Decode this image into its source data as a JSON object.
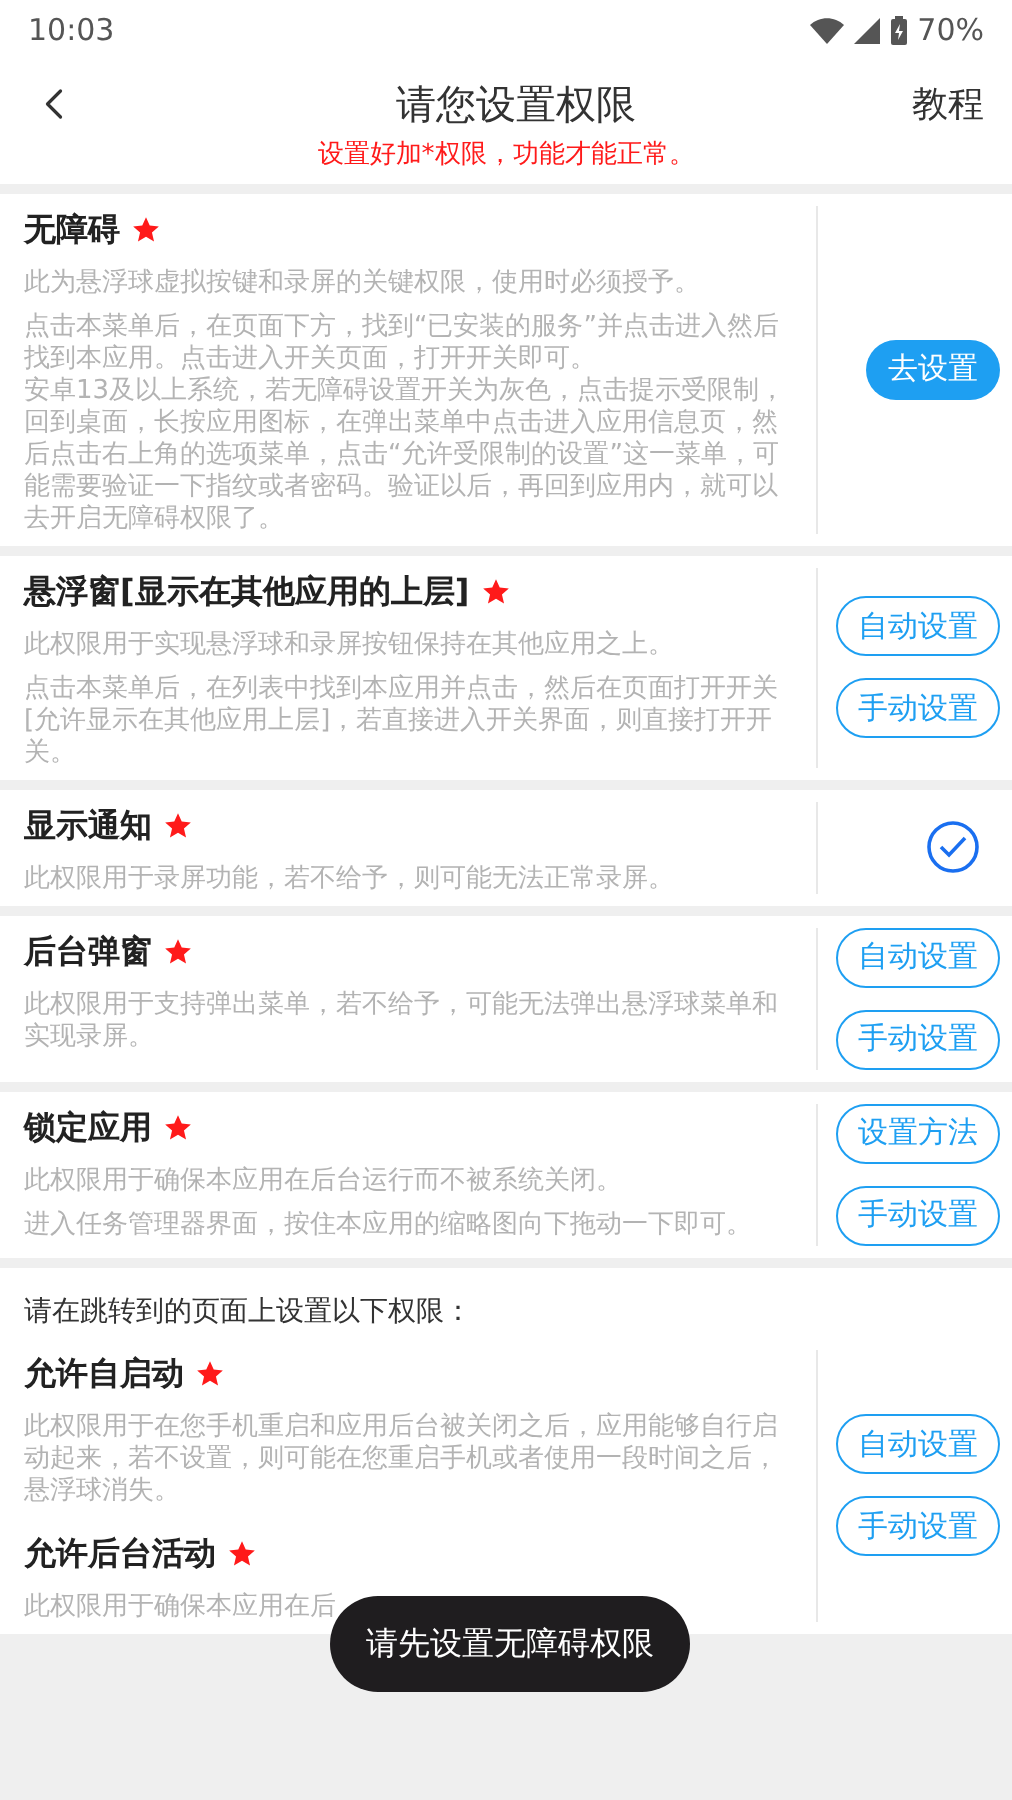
{
  "status_bar": {
    "time": "10:03",
    "battery": "70%"
  },
  "header": {
    "title": "请您设置权限",
    "action": "教程",
    "notice": "设置好加*权限，功能才能正常。"
  },
  "sections": [
    {
      "items": [
        {
          "title": "无障碍",
          "required": true,
          "paragraphs": [
            "此为悬浮球虚拟按键和录屏的关键权限，使用时必须授予。",
            "点击本菜单后，在页面下方，找到“已安装的服务”并点击进入然后找到本应用。点击进入开关页面，打开开关即可。",
            "安卓13及以上系统，若无障碍设置开关为灰色，点击提示受限制，回到桌面，长按应用图标，在弹出菜单中点击进入应用信息页，然后点击右上角的选项菜单，点击“允许受限制的设置”这一菜单，可能需要验证一下指纹或者密码。验证以后，再回到应用内，就可以去开启无障碍权限了。"
          ]
        }
      ],
      "actions": [
        {
          "kind": "filled",
          "label": "去设置"
        }
      ]
    },
    {
      "items": [
        {
          "title": "悬浮窗[显示在其他应用的上层]",
          "required": true,
          "paragraphs": [
            "此权限用于实现悬浮球和录屏按钮保持在其他应用之上。",
            "点击本菜单后，在列表中找到本应用并点击，然后在页面打开开关[允许显示在其他应用上层]，若直接进入开关界面，则直接打开开关。"
          ]
        }
      ],
      "actions": [
        {
          "kind": "outline",
          "label": "自动设置"
        },
        {
          "kind": "outline",
          "label": "手动设置"
        }
      ]
    },
    {
      "items": [
        {
          "title": "显示通知",
          "required": true,
          "paragraphs": [
            "此权限用于录屏功能，若不给予，则可能无法正常录屏。"
          ]
        }
      ],
      "actions": [
        {
          "kind": "check",
          "checked": true
        }
      ]
    },
    {
      "items": [
        {
          "title": "后台弹窗",
          "required": true,
          "paragraphs": [
            "此权限用于支持弹出菜单，若不给予，可能无法弹出悬浮球菜单和实现录屏。"
          ]
        }
      ],
      "actions": [
        {
          "kind": "outline",
          "label": "自动设置"
        },
        {
          "kind": "outline",
          "label": "手动设置"
        }
      ]
    },
    {
      "items": [
        {
          "title": "锁定应用",
          "required": true,
          "paragraphs": [
            "此权限用于确保本应用在后台运行而不被系统关闭。",
            "进入任务管理器界面，按住本应用的缩略图向下拖动一下即可。"
          ]
        }
      ],
      "actions": [
        {
          "kind": "outline",
          "label": "设置方法"
        },
        {
          "kind": "outline",
          "label": "手动设置"
        }
      ]
    },
    {
      "intro": "请在跳转到的页面上设置以下权限：",
      "items": [
        {
          "title": "允许自启动",
          "required": true,
          "paragraphs": [
            "此权限用于在您手机重启和应用后台被关闭之后，应用能够自行启动起来，若不设置，则可能在您重启手机或者使用一段时间之后，悬浮球消失。"
          ]
        },
        {
          "title": "允许后台活动",
          "required": true,
          "paragraphs": [
            "此权限用于确保本应用在后"
          ]
        }
      ],
      "actions": [
        {
          "kind": "outline",
          "label": "自动设置"
        },
        {
          "kind": "outline",
          "label": "手动设置"
        }
      ]
    }
  ],
  "toast": "请先设置无障碍权限"
}
